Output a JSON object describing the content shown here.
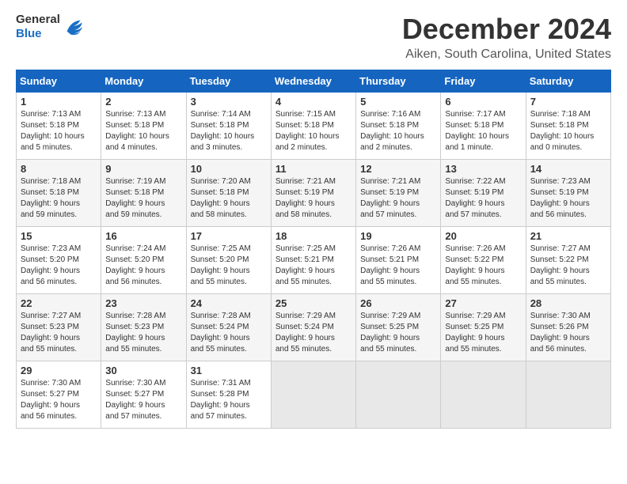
{
  "header": {
    "logo_line1": "General",
    "logo_line2": "Blue",
    "title": "December 2024",
    "subtitle": "Aiken, South Carolina, United States"
  },
  "calendar": {
    "days_of_week": [
      "Sunday",
      "Monday",
      "Tuesday",
      "Wednesday",
      "Thursday",
      "Friday",
      "Saturday"
    ],
    "weeks": [
      [
        {
          "day": "1",
          "info": "Sunrise: 7:13 AM\nSunset: 5:18 PM\nDaylight: 10 hours\nand 5 minutes."
        },
        {
          "day": "2",
          "info": "Sunrise: 7:13 AM\nSunset: 5:18 PM\nDaylight: 10 hours\nand 4 minutes."
        },
        {
          "day": "3",
          "info": "Sunrise: 7:14 AM\nSunset: 5:18 PM\nDaylight: 10 hours\nand 3 minutes."
        },
        {
          "day": "4",
          "info": "Sunrise: 7:15 AM\nSunset: 5:18 PM\nDaylight: 10 hours\nand 2 minutes."
        },
        {
          "day": "5",
          "info": "Sunrise: 7:16 AM\nSunset: 5:18 PM\nDaylight: 10 hours\nand 2 minutes."
        },
        {
          "day": "6",
          "info": "Sunrise: 7:17 AM\nSunset: 5:18 PM\nDaylight: 10 hours\nand 1 minute."
        },
        {
          "day": "7",
          "info": "Sunrise: 7:18 AM\nSunset: 5:18 PM\nDaylight: 10 hours\nand 0 minutes."
        }
      ],
      [
        {
          "day": "8",
          "info": "Sunrise: 7:18 AM\nSunset: 5:18 PM\nDaylight: 9 hours\nand 59 minutes."
        },
        {
          "day": "9",
          "info": "Sunrise: 7:19 AM\nSunset: 5:18 PM\nDaylight: 9 hours\nand 59 minutes."
        },
        {
          "day": "10",
          "info": "Sunrise: 7:20 AM\nSunset: 5:18 PM\nDaylight: 9 hours\nand 58 minutes."
        },
        {
          "day": "11",
          "info": "Sunrise: 7:21 AM\nSunset: 5:19 PM\nDaylight: 9 hours\nand 58 minutes."
        },
        {
          "day": "12",
          "info": "Sunrise: 7:21 AM\nSunset: 5:19 PM\nDaylight: 9 hours\nand 57 minutes."
        },
        {
          "day": "13",
          "info": "Sunrise: 7:22 AM\nSunset: 5:19 PM\nDaylight: 9 hours\nand 57 minutes."
        },
        {
          "day": "14",
          "info": "Sunrise: 7:23 AM\nSunset: 5:19 PM\nDaylight: 9 hours\nand 56 minutes."
        }
      ],
      [
        {
          "day": "15",
          "info": "Sunrise: 7:23 AM\nSunset: 5:20 PM\nDaylight: 9 hours\nand 56 minutes."
        },
        {
          "day": "16",
          "info": "Sunrise: 7:24 AM\nSunset: 5:20 PM\nDaylight: 9 hours\nand 56 minutes."
        },
        {
          "day": "17",
          "info": "Sunrise: 7:25 AM\nSunset: 5:20 PM\nDaylight: 9 hours\nand 55 minutes."
        },
        {
          "day": "18",
          "info": "Sunrise: 7:25 AM\nSunset: 5:21 PM\nDaylight: 9 hours\nand 55 minutes."
        },
        {
          "day": "19",
          "info": "Sunrise: 7:26 AM\nSunset: 5:21 PM\nDaylight: 9 hours\nand 55 minutes."
        },
        {
          "day": "20",
          "info": "Sunrise: 7:26 AM\nSunset: 5:22 PM\nDaylight: 9 hours\nand 55 minutes."
        },
        {
          "day": "21",
          "info": "Sunrise: 7:27 AM\nSunset: 5:22 PM\nDaylight: 9 hours\nand 55 minutes."
        }
      ],
      [
        {
          "day": "22",
          "info": "Sunrise: 7:27 AM\nSunset: 5:23 PM\nDaylight: 9 hours\nand 55 minutes."
        },
        {
          "day": "23",
          "info": "Sunrise: 7:28 AM\nSunset: 5:23 PM\nDaylight: 9 hours\nand 55 minutes."
        },
        {
          "day": "24",
          "info": "Sunrise: 7:28 AM\nSunset: 5:24 PM\nDaylight: 9 hours\nand 55 minutes."
        },
        {
          "day": "25",
          "info": "Sunrise: 7:29 AM\nSunset: 5:24 PM\nDaylight: 9 hours\nand 55 minutes."
        },
        {
          "day": "26",
          "info": "Sunrise: 7:29 AM\nSunset: 5:25 PM\nDaylight: 9 hours\nand 55 minutes."
        },
        {
          "day": "27",
          "info": "Sunrise: 7:29 AM\nSunset: 5:25 PM\nDaylight: 9 hours\nand 55 minutes."
        },
        {
          "day": "28",
          "info": "Sunrise: 7:30 AM\nSunset: 5:26 PM\nDaylight: 9 hours\nand 56 minutes."
        }
      ],
      [
        {
          "day": "29",
          "info": "Sunrise: 7:30 AM\nSunset: 5:27 PM\nDaylight: 9 hours\nand 56 minutes."
        },
        {
          "day": "30",
          "info": "Sunrise: 7:30 AM\nSunset: 5:27 PM\nDaylight: 9 hours\nand 57 minutes."
        },
        {
          "day": "31",
          "info": "Sunrise: 7:31 AM\nSunset: 5:28 PM\nDaylight: 9 hours\nand 57 minutes."
        },
        {
          "day": "",
          "info": ""
        },
        {
          "day": "",
          "info": ""
        },
        {
          "day": "",
          "info": ""
        },
        {
          "day": "",
          "info": ""
        }
      ]
    ]
  }
}
